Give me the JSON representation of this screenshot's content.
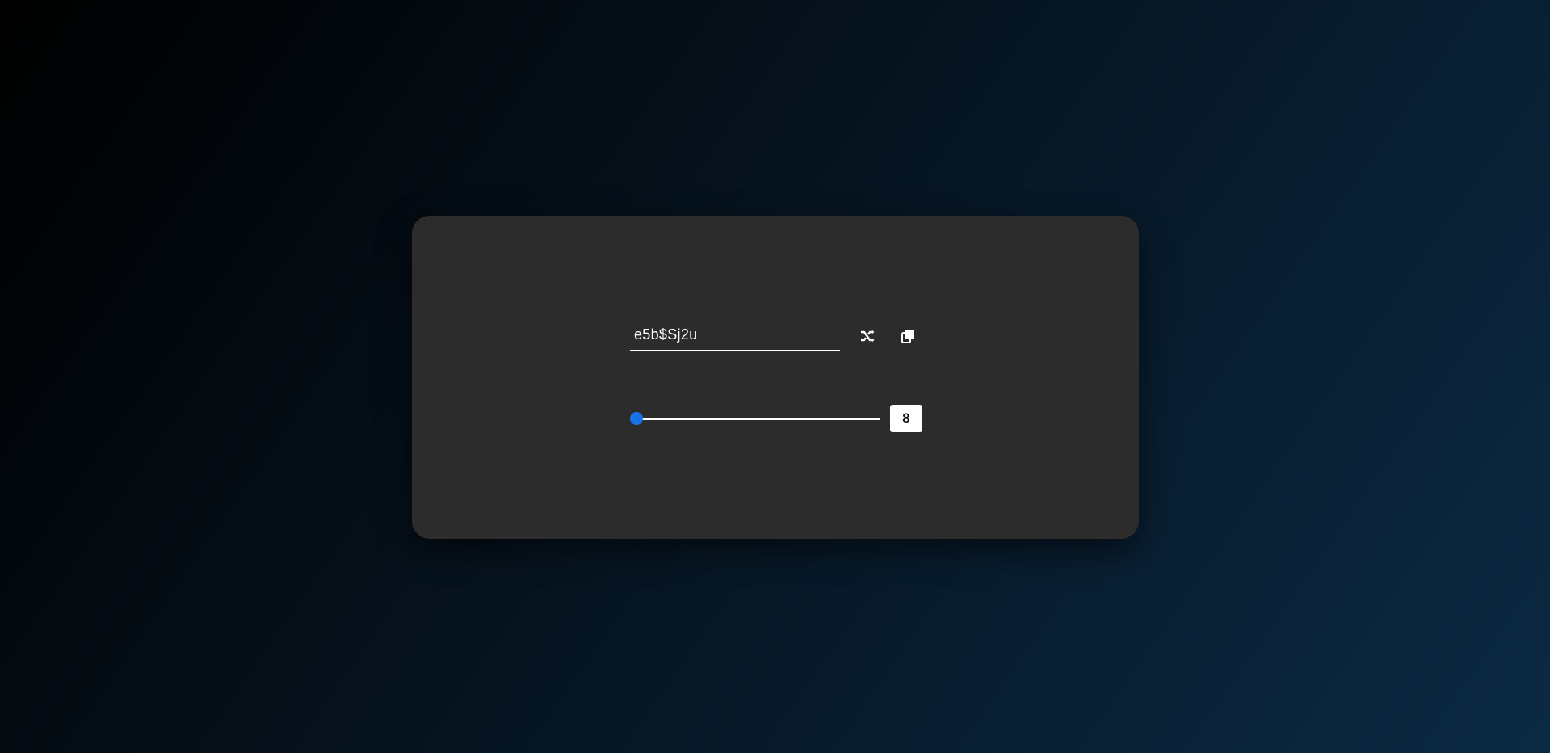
{
  "generator": {
    "password_value": "e5b$Sj2u",
    "shuffle_icon": "shuffle-icon",
    "copy_icon": "copy-icon",
    "length": {
      "value": "8",
      "slider_fraction": 0.0
    }
  },
  "colors": {
    "card_background": "#2c2c2c",
    "slider_accent": "#1674e8",
    "text": "#ffffff"
  }
}
